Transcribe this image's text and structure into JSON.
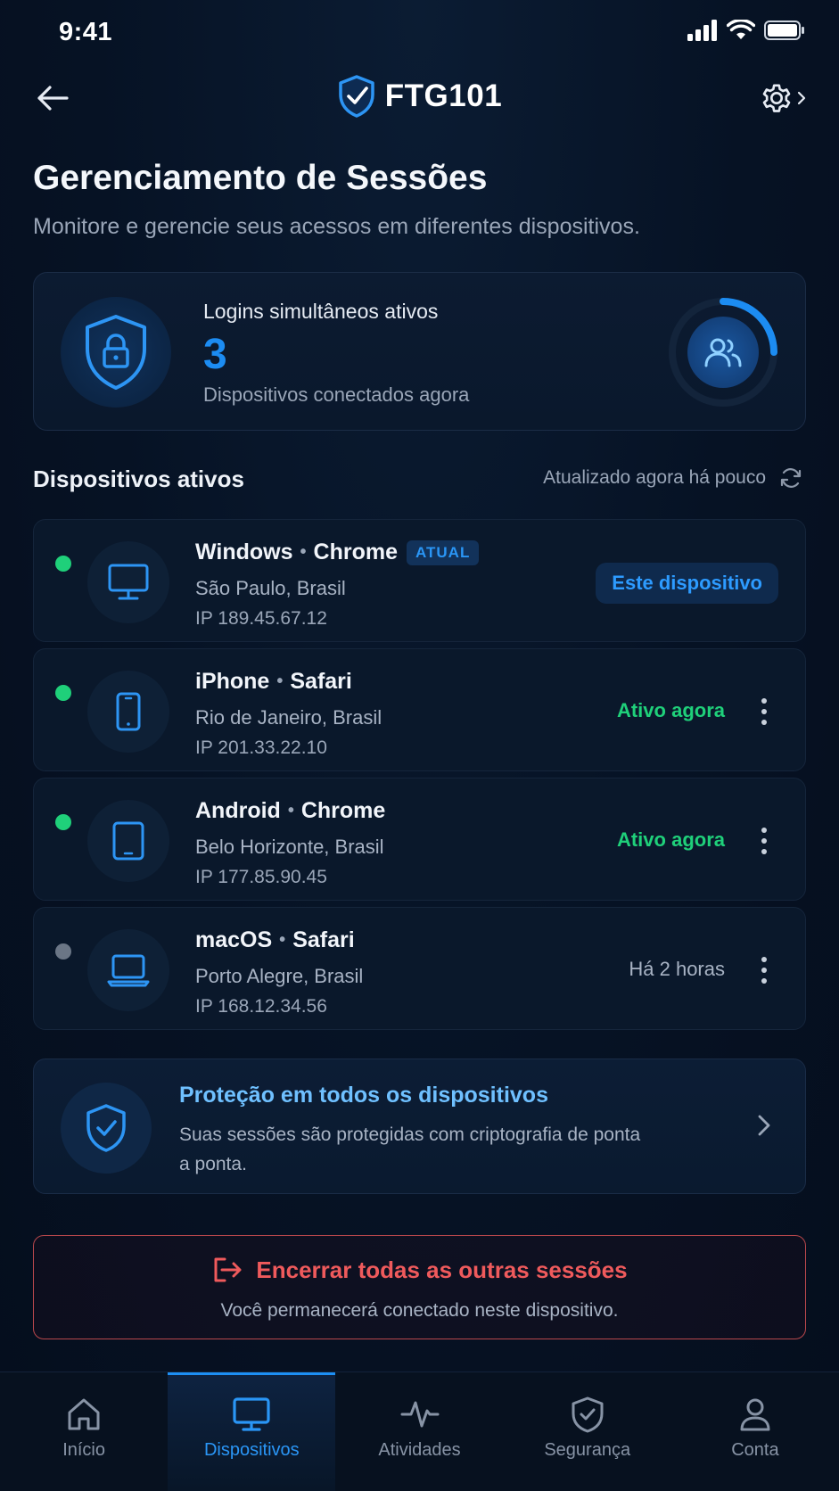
{
  "status_bar": {
    "time": "9:41"
  },
  "header": {
    "brand": "FTG101"
  },
  "page": {
    "title": "Gerenciamento de Sessões",
    "subtitle": "Monitore e gerencie seus acessos em diferentes dispositivos."
  },
  "summary": {
    "label": "Logins simultâneos ativos",
    "count": "3",
    "caption": "Dispositivos conectados agora"
  },
  "devices_section": {
    "title": "Dispositivos ativos",
    "updated": "Atualizado agora há pouco"
  },
  "devices": [
    {
      "os": "Windows",
      "browser": "Chrome",
      "badge": "ATUAL",
      "location": "São Paulo, Brasil",
      "ip": "IP 189.45.67.12",
      "status": "Este dispositivo",
      "online": true,
      "icon": "monitor-icon"
    },
    {
      "os": "iPhone",
      "browser": "Safari",
      "location": "Rio de Janeiro, Brasil",
      "ip": "IP 201.33.22.10",
      "status": "Ativo agora",
      "online": true,
      "icon": "smartphone-icon"
    },
    {
      "os": "Android",
      "browser": "Chrome",
      "location": "Belo Horizonte, Brasil",
      "ip": "IP 177.85.90.45",
      "status": "Ativo agora",
      "online": true,
      "icon": "tablet-icon"
    },
    {
      "os": "macOS",
      "browser": "Safari",
      "location": "Porto Alegre, Brasil",
      "ip": "IP 168.12.34.56",
      "status": "Há 2 horas",
      "online": false,
      "icon": "laptop-icon"
    }
  ],
  "protection": {
    "title": "Proteção em todos os dispositivos",
    "text": "Suas sessões são protegidas com criptografia de ponta a ponta."
  },
  "end_sessions": {
    "label": "Encerrar todas as outras sessões",
    "note": "Você permanecerá conectado neste dispositivo."
  },
  "nav": {
    "items": [
      {
        "label": "Início",
        "icon": "home-icon"
      },
      {
        "label": "Dispositivos",
        "icon": "monitor-icon",
        "active": true
      },
      {
        "label": "Atividades",
        "icon": "activity-icon"
      },
      {
        "label": "Segurança",
        "icon": "shield-check-icon"
      },
      {
        "label": "Conta",
        "icon": "user-icon"
      }
    ]
  },
  "colors": {
    "accent": "#1c8cf2",
    "online": "#1fd07a",
    "offline": "#6b7686",
    "danger": "#ef5a5c",
    "background": "#061224"
  }
}
